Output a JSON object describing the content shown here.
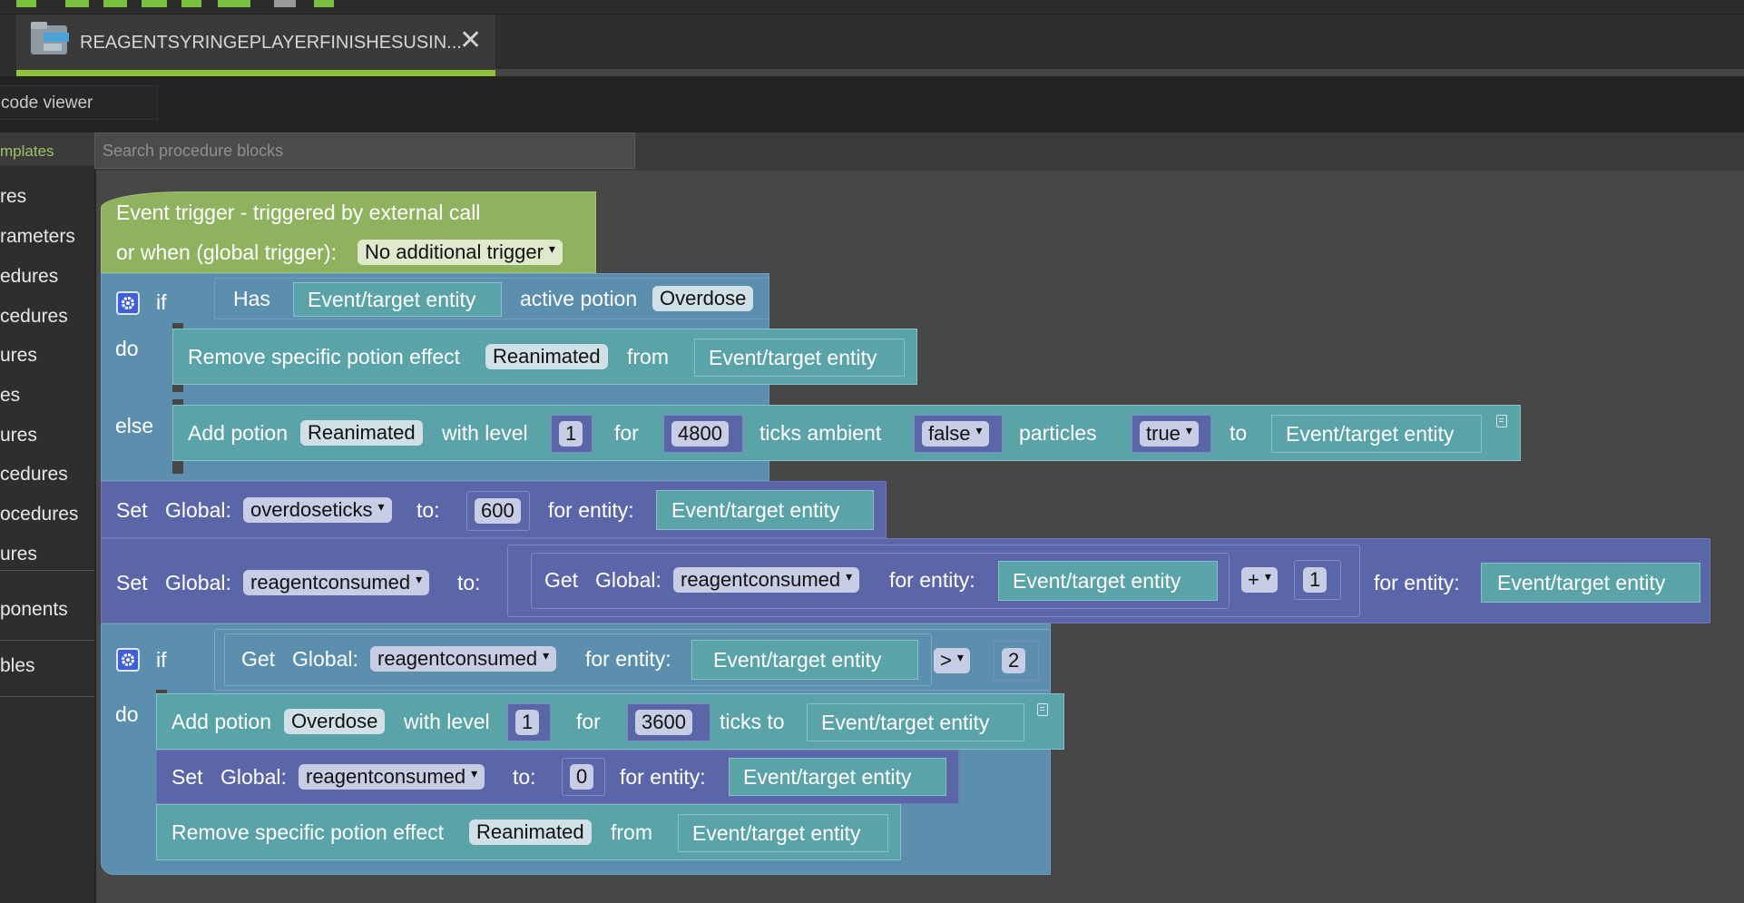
{
  "tab": {
    "title": "REAGENTSYRINGEPLAYERFINISHESUSIN...",
    "close": "✕"
  },
  "code_viewer": "code viewer",
  "sidebar": {
    "header": "mplates",
    "items": [
      "res",
      "rameters",
      "edures",
      "cedures",
      "ures",
      "es",
      "ures",
      "cedures",
      "ocedures",
      "ures",
      "ponents",
      "bles"
    ]
  },
  "search": {
    "placeholder": "Search procedure blocks"
  },
  "event": {
    "line1": "Event trigger - triggered by external call",
    "line2": "or when (global trigger):",
    "trigger": "No additional trigger"
  },
  "if1": {
    "if": "if",
    "do": "do",
    "else": "else",
    "has": "Has",
    "entity": "Event/target entity",
    "active_potion": "active potion",
    "potion": "Overdose",
    "remove": {
      "label": "Remove specific potion effect",
      "effect": "Reanimated",
      "from": "from",
      "entity": "Event/target entity"
    },
    "add": {
      "label": "Add potion",
      "potion": "Reanimated",
      "with_level": "with level",
      "level": "1",
      "for": "for",
      "ticks": "4800",
      "ticks_ambient": "ticks ambient",
      "ambient": "false",
      "particles": "particles",
      "particles_val": "true",
      "to": "to",
      "entity": "Event/target entity"
    }
  },
  "set1": {
    "set": "Set",
    "global": "Global:",
    "var": "overdoseticks",
    "to": "to:",
    "value": "600",
    "for_entity": "for entity:",
    "entity": "Event/target entity"
  },
  "set2": {
    "set": "Set",
    "global": "Global:",
    "var": "reagentconsumed",
    "to": "to:",
    "get": "Get",
    "get_global": "Global:",
    "get_var": "reagentconsumed",
    "get_for": "for entity:",
    "get_entity": "Event/target entity",
    "op": "+",
    "operand": "1",
    "for_entity": "for entity:",
    "entity": "Event/target entity"
  },
  "if2": {
    "if": "if",
    "do": "do",
    "get": "Get",
    "global": "Global:",
    "var": "reagentconsumed",
    "for_entity": "for entity:",
    "entity": "Event/target entity",
    "op": ">",
    "operand": "2",
    "add": {
      "label": "Add potion",
      "potion": "Overdose",
      "with_level": "with level",
      "level": "1",
      "for": "for",
      "ticks": "3600",
      "ticks_to": "ticks to",
      "entity": "Event/target entity"
    },
    "set": {
      "set": "Set",
      "global": "Global:",
      "var": "reagentconsumed",
      "to": "to:",
      "value": "0",
      "for_entity": "for entity:",
      "entity": "Event/target entity"
    },
    "remove": {
      "label": "Remove specific potion effect",
      "effect": "Reanimated",
      "from": "from",
      "entity": "Event/target entity"
    }
  }
}
